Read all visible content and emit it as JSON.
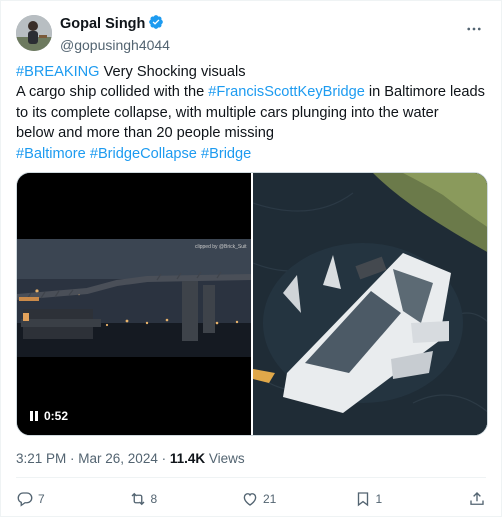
{
  "author": {
    "display_name": "Gopal Singh",
    "handle": "@gopusingh4044",
    "verified": true
  },
  "tweet": {
    "line1_tag": "#BREAKING",
    "line1_rest": " Very Shocking visuals",
    "line2_pre": "A cargo ship collided with the ",
    "line2_tag": "#FrancisScottKeyBridge",
    "line2_post": " in Baltimore leads",
    "line3": "to its complete collapse, with multiple cars plunging into the water",
    "line4": "below and more than 20 people missing",
    "hashtags": [
      "#Baltimore",
      "#BridgeCollapse",
      "#Bridge"
    ]
  },
  "media": {
    "video_duration": "0:52",
    "video_credit": "clipped by @Brick_Suit"
  },
  "meta": {
    "time": "3:21 PM",
    "dot": " · ",
    "date": "Mar 26, 2024",
    "views_count": "11.4K",
    "views_label": " Views"
  },
  "actions": {
    "replies": "7",
    "reposts": "8",
    "likes": "21",
    "bookmarks": "1"
  },
  "colors": {
    "link": "#1d9bf0",
    "text": "#0f1419",
    "muted": "#536471",
    "verified": "#1d9bf0"
  }
}
